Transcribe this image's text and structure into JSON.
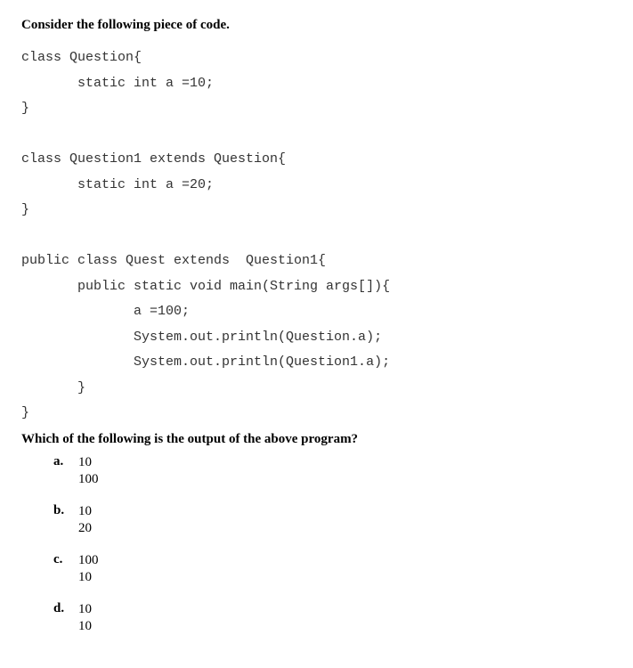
{
  "heading": "Consider the following piece of code.",
  "code": "class Question{\n       static int a =10;\n}\n\nclass Question1 extends Question{\n       static int a =20;\n}\n\npublic class Quest extends  Question1{\n       public static void main(String args[]){\n              a =100;\n              System.out.println(Question.a);\n              System.out.println(Question1.a);\n       }\n}",
  "question": "Which of the following is the output of the above program?",
  "options": {
    "a": {
      "label": "a.",
      "text": "10\n100"
    },
    "b": {
      "label": "b.",
      "text": "10\n20"
    },
    "c": {
      "label": "c.",
      "text": "100\n10"
    },
    "d": {
      "label": "d.",
      "text": "10\n10"
    }
  }
}
